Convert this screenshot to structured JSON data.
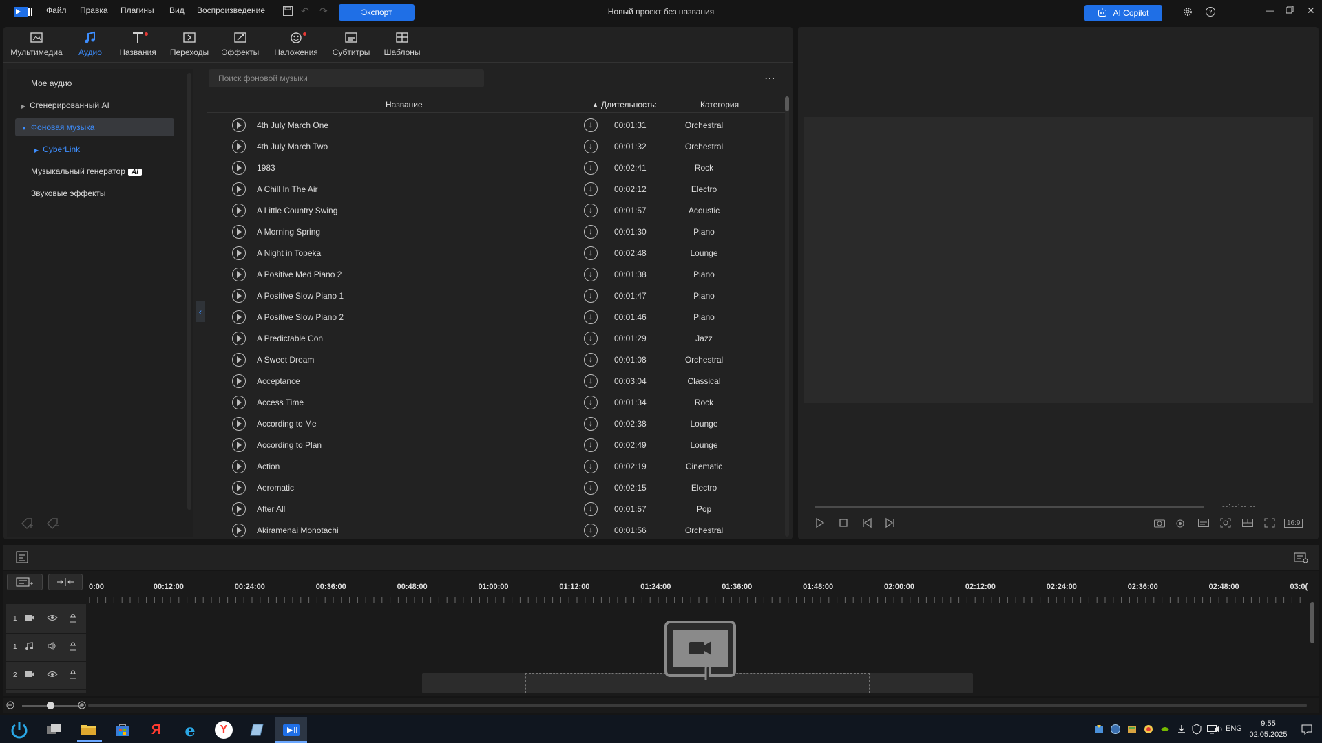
{
  "menu": {
    "file": "Файл",
    "edit": "Правка",
    "plugins": "Плагины",
    "view": "Вид",
    "playback": "Воспроизведение",
    "export_label": "Экспорт",
    "project_title": "Новый проект без названия",
    "copilot_label": "AI Copilot"
  },
  "tabs": [
    {
      "label": "Мультимедиа",
      "icon": "media-icon"
    },
    {
      "label": "Аудио",
      "icon": "music-note-icon",
      "active": true
    },
    {
      "label": "Названия",
      "icon": "title-icon"
    },
    {
      "label": "Переходы",
      "icon": "transition-icon"
    },
    {
      "label": "Эффекты",
      "icon": "effects-icon"
    },
    {
      "label": "Наложения",
      "icon": "overlay-icon"
    },
    {
      "label": "Субтитры",
      "icon": "subtitles-icon"
    },
    {
      "label": "Шаблоны",
      "icon": "templates-icon"
    }
  ],
  "sidebar": {
    "my_audio": "Мое аудио",
    "ai_generated": "Сгенерированный AI",
    "background_music": "Фоновая музыка",
    "cyberlink": "CyberLink",
    "music_generator": "Музыкальный генератор",
    "ai_badge": "AI",
    "sound_effects": "Звуковые эффекты"
  },
  "search": {
    "placeholder": "Поиск фоновой музыки"
  },
  "table": {
    "col_name": "Название",
    "col_duration": "Длительность:",
    "col_category": "Категория",
    "rows": [
      {
        "name": "4th July March One",
        "duration": "00:01:31",
        "category": "Orchestral"
      },
      {
        "name": "4th July March Two",
        "duration": "00:01:32",
        "category": "Orchestral"
      },
      {
        "name": "1983",
        "duration": "00:02:41",
        "category": "Rock"
      },
      {
        "name": "A Chill In The Air",
        "duration": "00:02:12",
        "category": "Electro"
      },
      {
        "name": "A Little Country Swing",
        "duration": "00:01:57",
        "category": "Acoustic"
      },
      {
        "name": "A Morning Spring",
        "duration": "00:01:30",
        "category": "Piano"
      },
      {
        "name": "A Night in Topeka",
        "duration": "00:02:48",
        "category": "Lounge"
      },
      {
        "name": "A Positive Med Piano 2",
        "duration": "00:01:38",
        "category": "Piano"
      },
      {
        "name": "A Positive Slow Piano 1",
        "duration": "00:01:47",
        "category": "Piano"
      },
      {
        "name": "A Positive Slow Piano 2",
        "duration": "00:01:46",
        "category": "Piano"
      },
      {
        "name": "A Predictable Con",
        "duration": "00:01:29",
        "category": "Jazz"
      },
      {
        "name": "A Sweet Dream",
        "duration": "00:01:08",
        "category": "Orchestral"
      },
      {
        "name": "Acceptance",
        "duration": "00:03:04",
        "category": "Classical"
      },
      {
        "name": "Access Time",
        "duration": "00:01:34",
        "category": "Rock"
      },
      {
        "name": "According to Me",
        "duration": "00:02:38",
        "category": "Lounge"
      },
      {
        "name": "According to Plan",
        "duration": "00:02:49",
        "category": "Lounge"
      },
      {
        "name": "Action",
        "duration": "00:02:19",
        "category": "Cinematic"
      },
      {
        "name": "Aeromatic",
        "duration": "00:02:15",
        "category": "Electro"
      },
      {
        "name": "After All",
        "duration": "00:01:57",
        "category": "Pop"
      },
      {
        "name": "Akiramenai Monotachi",
        "duration": "00:01:56",
        "category": "Orchestral"
      }
    ]
  },
  "preview": {
    "timecode": "--:--:--.--",
    "aspect": "16:9"
  },
  "timeline": {
    "ticks": [
      "0:00",
      "00:12:00",
      "00:24:00",
      "00:36:00",
      "00:48:00",
      "01:00:00",
      "01:12:00",
      "01:24:00",
      "01:36:00",
      "01:48:00",
      "02:00:00",
      "02:12:00",
      "02:24:00",
      "02:36:00",
      "02:48:00",
      "03:0("
    ],
    "tracks": [
      {
        "num": "1",
        "kind": "video"
      },
      {
        "num": "1",
        "kind": "audio"
      },
      {
        "num": "2",
        "kind": "video"
      }
    ]
  },
  "taskbar": {
    "lang": "ENG",
    "time": "9:55",
    "date": "02.05.2025",
    "yandex_letter": "Я",
    "yandex_browser_letter": "Y"
  },
  "colors": {
    "accent": "#1f6fe6",
    "active_tab": "#3d8eff",
    "panel": "#222222",
    "background": "#151515"
  }
}
